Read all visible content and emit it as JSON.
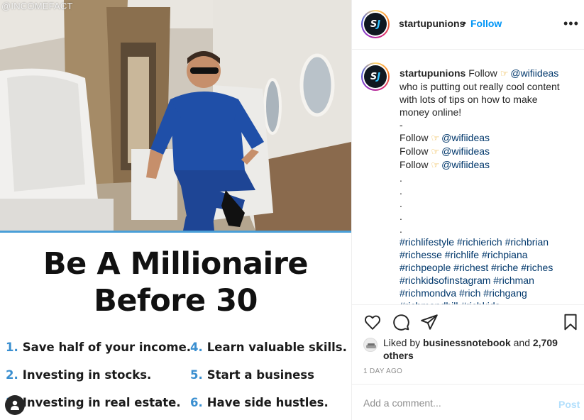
{
  "media": {
    "watermark": "@INCOMEFACT",
    "headline_line1": "Be A Millionaire",
    "headline_line2": "Before 30",
    "tips": [
      {
        "num": "1.",
        "text": "Save half of your income."
      },
      {
        "num": "2.",
        "text": "Investing in stocks."
      },
      {
        "num": "3.",
        "text": "Investing in real estate."
      },
      {
        "num": "4.",
        "text": "Learn valuable skills."
      },
      {
        "num": "5.",
        "text": "Start a business"
      },
      {
        "num": "6.",
        "text": "Have side hustles."
      }
    ]
  },
  "header": {
    "avatar_text_s": "S",
    "avatar_text_j": "J",
    "username": "startupunions",
    "dot": "•",
    "follow": "Follow",
    "more": "•••"
  },
  "caption": {
    "username": "startupunions",
    "intro_follow": "Follow",
    "intro_mention": "@wifiideas",
    "intro_text": "who is putting out really cool content with lots of tips on how to make money online!",
    "dash": "-",
    "follow_lines": [
      {
        "label": "Follow",
        "mention": "@wifiideas"
      },
      {
        "label": "Follow",
        "mention": "@wifiideas"
      },
      {
        "label": "Follow",
        "mention": "@wifiideas"
      }
    ],
    "dots": [
      ".",
      ".",
      ".",
      ".",
      "."
    ],
    "hashtags": "#richlifestyle #richierich #richbrian #richesse #richlife #richpiana #richpeople #richest #riche #riches #richkidsofinstagram #richman #richmondva #rich #richgang #richmondhill #richkids"
  },
  "likes": {
    "prefix": "Liked by",
    "user": "businessnotebook",
    "mid": "and",
    "others": "2,709 others"
  },
  "timestamp": "1 DAY AGO",
  "comment_box": {
    "placeholder": "Add a comment...",
    "post": "Post"
  },
  "colors": {
    "link": "#00376b",
    "follow": "#0095f6",
    "tip_number": "#3a8fd0",
    "post_disabled": "#b2dffc"
  }
}
